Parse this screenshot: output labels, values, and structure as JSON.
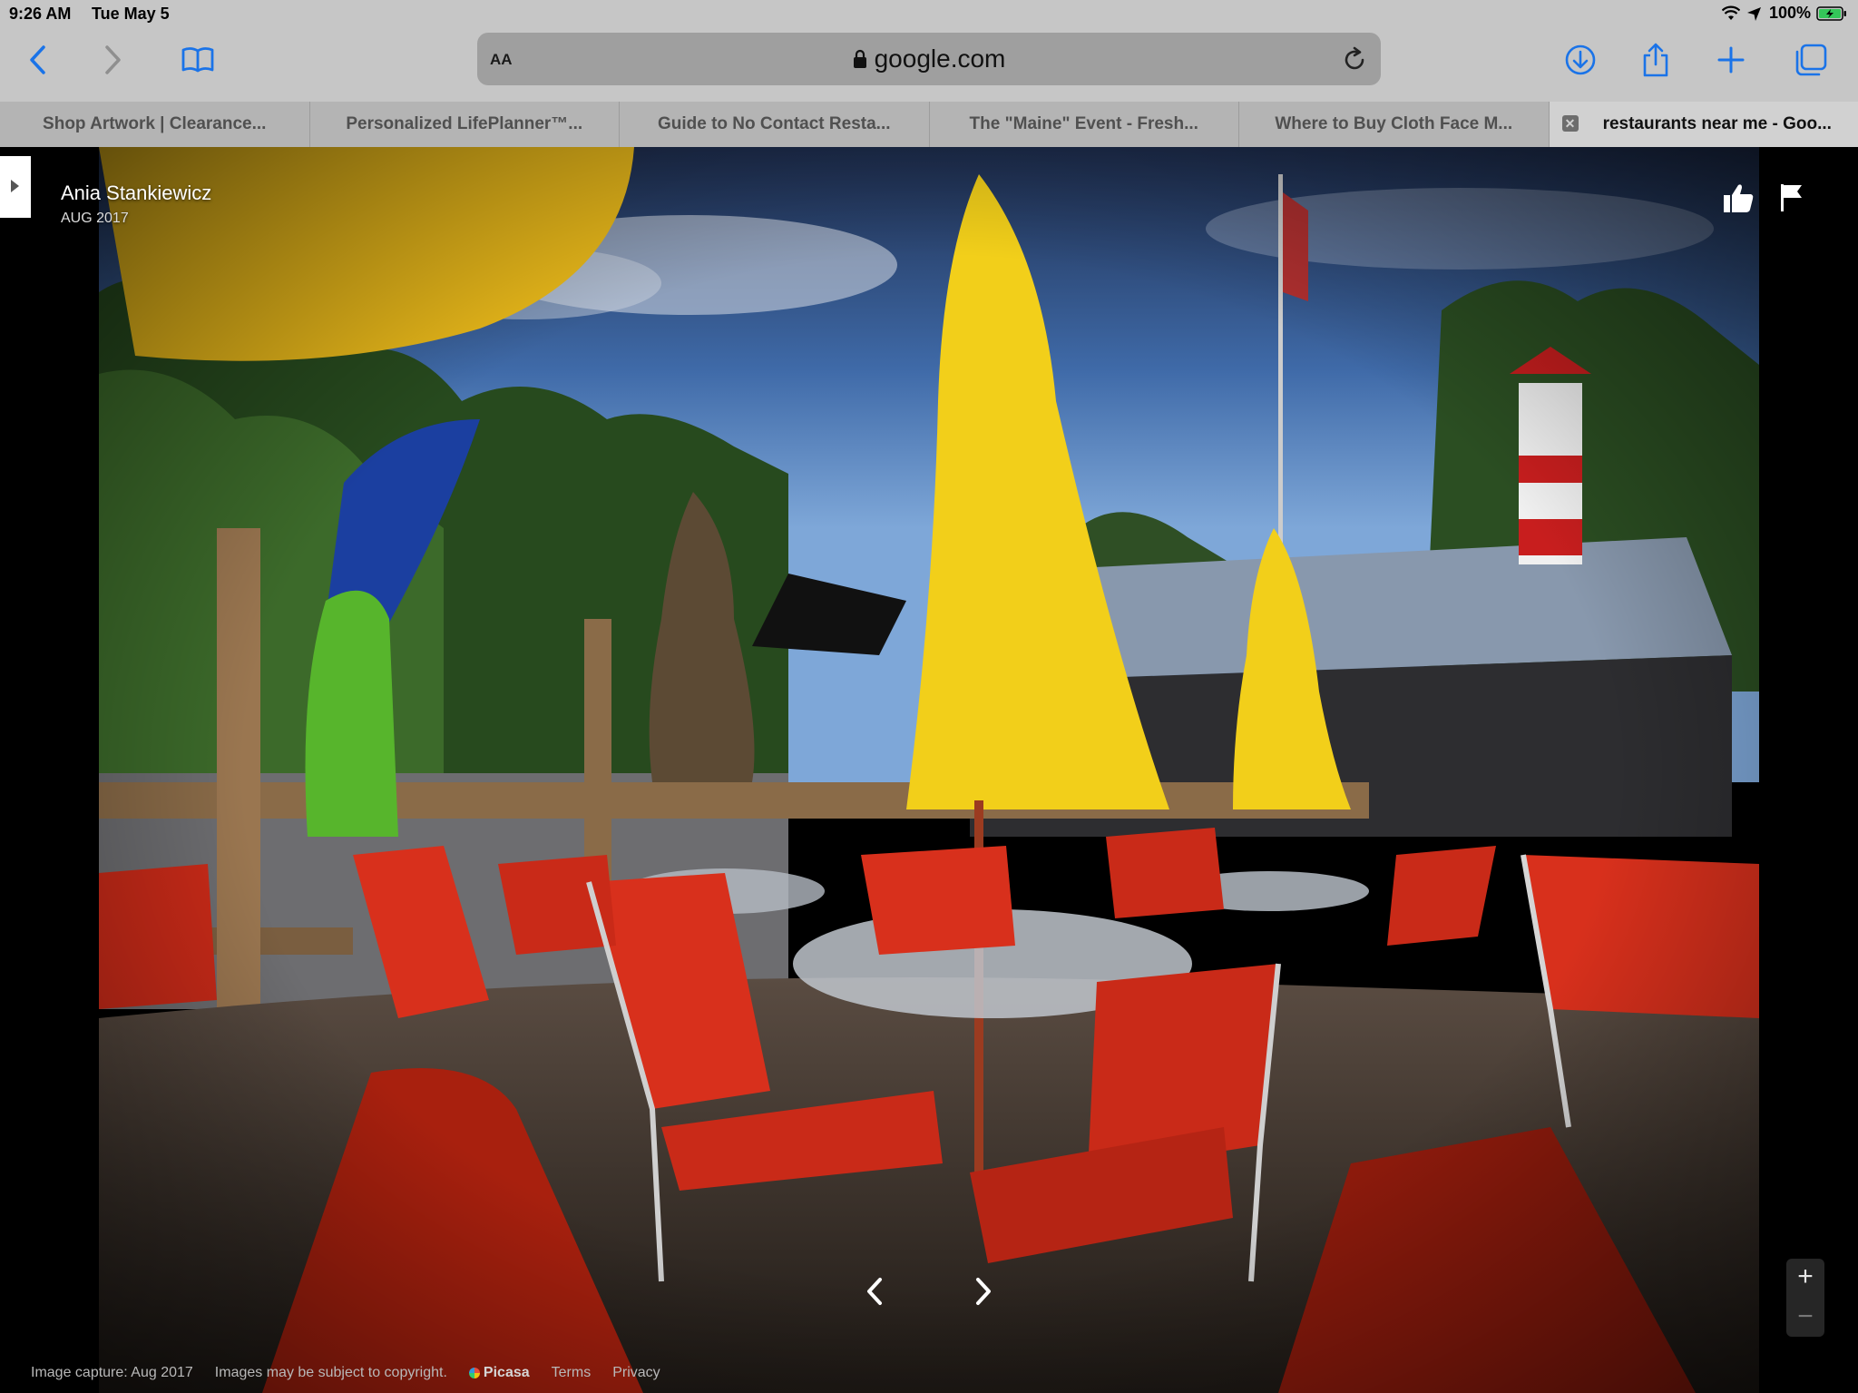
{
  "status_bar": {
    "time": "9:26 AM",
    "date": "Tue May 5",
    "battery": "100%"
  },
  "toolbar": {
    "text_size_label": "AA",
    "url": "google.com"
  },
  "tabs": [
    {
      "title": "Shop Artwork | Clearance..."
    },
    {
      "title": "Personalized LifePlanner™..."
    },
    {
      "title": "Guide to No Contact Resta..."
    },
    {
      "title": "The \"Maine\" Event - Fresh..."
    },
    {
      "title": "Where to Buy Cloth Face M..."
    },
    {
      "title": "restaurants near me - Goo...",
      "active": true
    }
  ],
  "viewer": {
    "author": "Ania Stankiewicz",
    "capture_date": "AUG 2017",
    "footer": {
      "capture": "Image capture: Aug 2017",
      "copyright": "Images may be subject to copyright.",
      "brand": "Picasa",
      "terms": "Terms",
      "privacy": "Privacy"
    },
    "zoom_in": "+",
    "zoom_out": "−"
  },
  "colors": {
    "accent": "#1a73e8",
    "chrome": "#c6c6c6",
    "chair_red": "#d8301c",
    "umbrella_yellow": "#f4d31a"
  }
}
